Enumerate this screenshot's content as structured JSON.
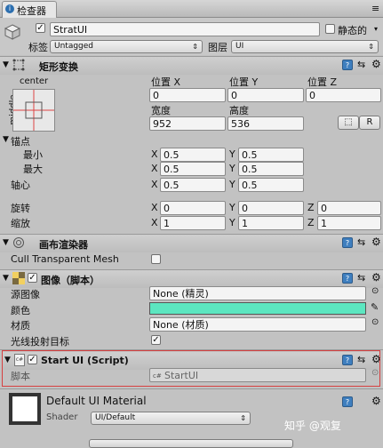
{
  "tab": {
    "title": "检查器"
  },
  "object": {
    "name": "StratUI",
    "static_label": "静态的",
    "tag_label": "标签",
    "tag_value": "Untagged",
    "layer_label": "图层",
    "layer_value": "UI"
  },
  "rect_transform": {
    "title": "矩形变换",
    "anchor_h": "center",
    "anchor_v": "middle",
    "pos_x_label": "位置 X",
    "pos_y_label": "位置 Y",
    "pos_z_label": "位置 Z",
    "pos_x": "0",
    "pos_y": "0",
    "pos_z": "0",
    "width_label": "宽度",
    "height_label": "高度",
    "width": "952",
    "height": "536",
    "raw_button": "R",
    "anchors_label": "锚点",
    "min_label": "最小",
    "max_label": "最大",
    "pivot_label": "轴心",
    "min_x": "0.5",
    "min_y": "0.5",
    "max_x": "0.5",
    "max_y": "0.5",
    "pivot_x": "0.5",
    "pivot_y": "0.5",
    "rotation_label": "旋转",
    "scale_label": "缩放",
    "rot_x": "0",
    "rot_y": "0",
    "rot_z": "0",
    "scale_x": "1",
    "scale_y": "1",
    "scale_z": "1",
    "axis_x": "X",
    "axis_y": "Y",
    "axis_z": "Z"
  },
  "canvas_renderer": {
    "title": "画布渲染器",
    "cull_label": "Cull Transparent Mesh"
  },
  "image": {
    "title": "图像（脚本）",
    "source_label": "源图像",
    "source_value": "None (精灵)",
    "color_label": "颜色",
    "color": "#5ce6c0",
    "material_label": "材质",
    "material_value": "None (材质)",
    "raycast_label": "光线投射目标"
  },
  "script": {
    "title": "Start UI (Script)",
    "script_label": "脚本",
    "script_value": "StartUI"
  },
  "material": {
    "name": "Default UI Material",
    "shader_label": "Shader",
    "shader_value": "UI/Default"
  },
  "watermark": "知乎 @观复"
}
